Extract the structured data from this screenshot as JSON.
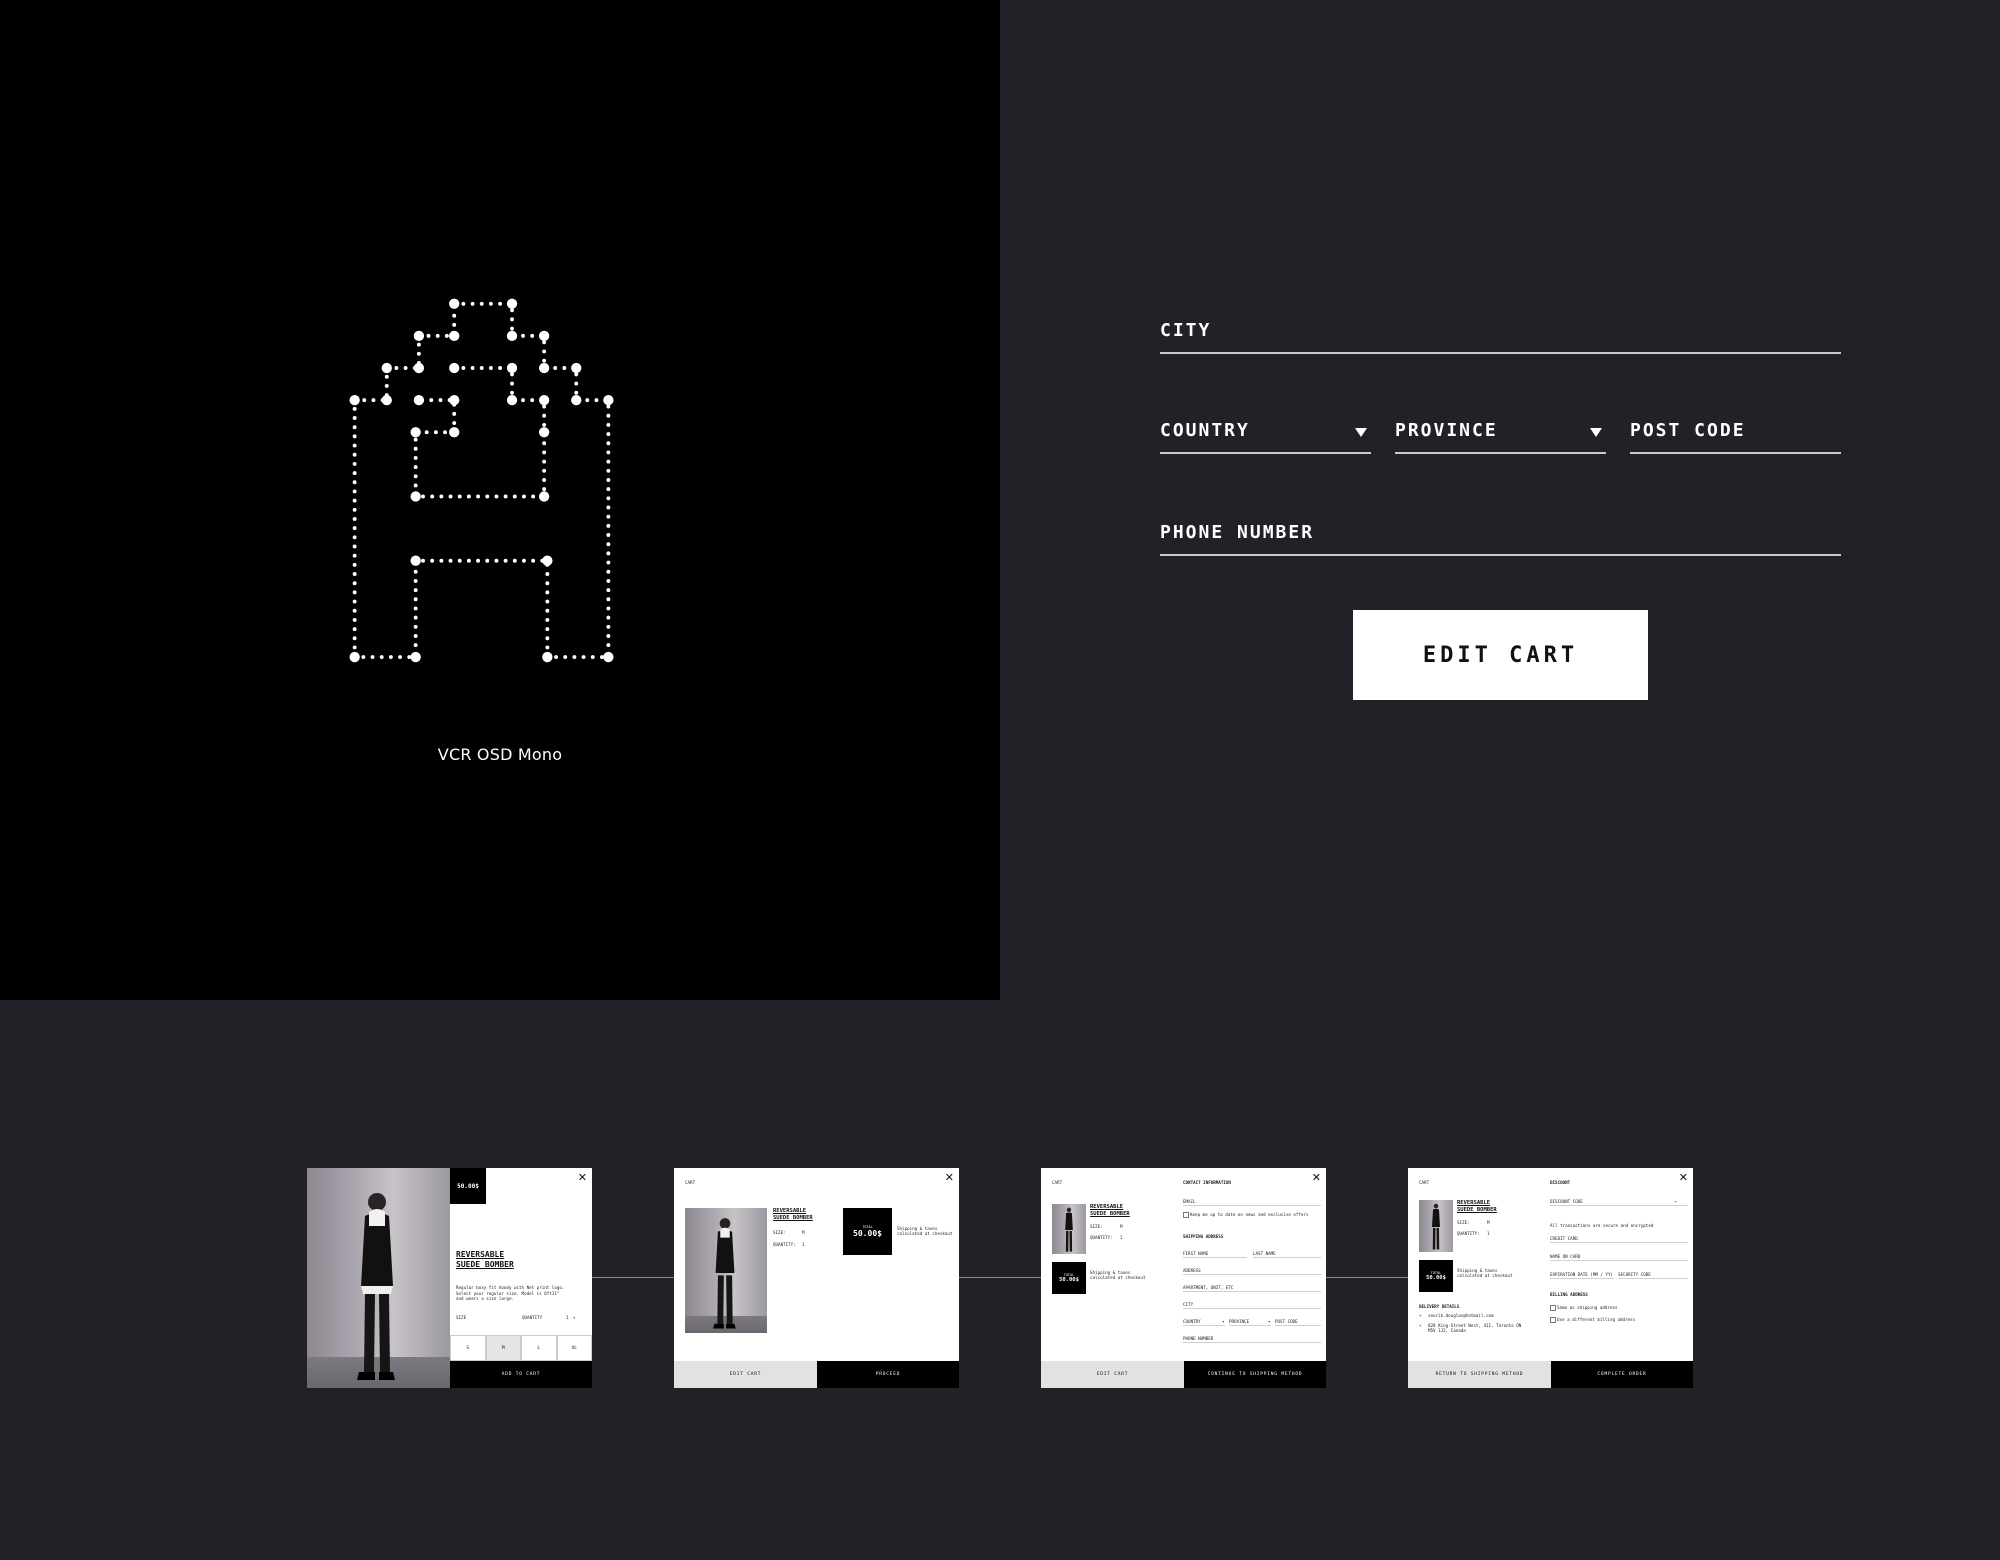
{
  "font_panel": {
    "font_name": "VCR OSD Mono"
  },
  "address_form": {
    "city_placeholder": "CITY",
    "country_placeholder": "COUNTRY",
    "province_placeholder": "PROVINCE",
    "postcode_placeholder": "POST CODE",
    "phone_placeholder": "PHONE NUMBER",
    "edit_cart_label": "EDIT CART"
  },
  "screens": {
    "product": {
      "price": "50.00$",
      "title_line1": "REVERSABLE",
      "title_line2": "SUEDE BOMBER",
      "desc_line1": "Regular boxy fit hoody with Net print logo.",
      "desc_line2": "Select your regular size. Model is 6ft11\"",
      "desc_line3": "and wears a size large.",
      "size_label": "SIZE",
      "quantity_label": "QUANTITY",
      "quantity_value": "1",
      "sizes": [
        "S",
        "M",
        "L",
        "XL"
      ],
      "add_to_cart": "ADD TO CART"
    },
    "cart": {
      "heading": "CART",
      "title_line1": "REVERSABLE",
      "title_line2": "SUEDE BOMBER",
      "size_label": "SIZE:",
      "size_value": "M",
      "quantity_label": "QUANTITY:",
      "quantity_value": "1",
      "total_label": "TOTAL",
      "total_value": "50.00$",
      "shipping_note_line1": "Shipping & taxes",
      "shipping_note_line2": "calculated at checkout",
      "edit_cart": "EDIT CART",
      "proceed": "PROCEED"
    },
    "contact": {
      "cart_heading": "CART",
      "title_line1": "REVERSABLE",
      "title_line2": "SUEDE BOMBER",
      "size_label": "SIZE:",
      "size_value": "M",
      "quantity_label": "QUANTITY:",
      "quantity_value": "1",
      "total_label": "TOTAL",
      "total_value": "50.00$",
      "shipping_note_line1": "Shipping & taxes",
      "shipping_note_line2": "calculated at checkout",
      "contact_heading": "CONTACT INFORMATION",
      "email_label": "EMAIL",
      "offers_checkbox": "Keep me up to date on news and exclusive offers",
      "shipping_heading": "SHIPPING ADDRESS",
      "first_name": "FIRST NAME",
      "last_name": "LAST NAME",
      "address": "ADDRESS",
      "apartment": "APARTMENT, UNIT, ETC",
      "city": "CITY",
      "country": "COUNTRY",
      "province": "PROVINCE",
      "post_code": "POST CODE",
      "phone": "PHONE NUMBER",
      "edit_cart": "EDIT CART",
      "continue": "CONTINUE TO SHIPPING METHOD"
    },
    "payment": {
      "cart_heading": "CART",
      "title_line1": "REVERSABLE",
      "title_line2": "SUEDE BOMBER",
      "size_label": "SIZE:",
      "size_value": "M",
      "quantity_label": "QUANTITY:",
      "quantity_value": "1",
      "total_label": "TOTAL",
      "total_value": "50.00$",
      "shipping_note_line1": "Shipping & taxes",
      "shipping_note_line2": "calculated at checkout",
      "delivery_heading": "DELIVERY DETAILS",
      "delivery_email": "seurik.douglas@hotmail.com",
      "delivery_address_line1": "828 King Street West, 411, Toronto ON",
      "delivery_address_line2": "M5V 1J2, Canada",
      "discount_heading": "DISCOUNT",
      "discount_code": "DISCOUNT CODE",
      "secure_note": "All transactions are secure and encrypted",
      "credit_card": "CREDIT CARD",
      "name_on_card": "NAME ON CARD",
      "expiration": "EXPIRATION DATE (MM / YY)",
      "security_code": "SECURITY CODE",
      "billing_heading": "BILLING ADDRESS",
      "same_as_shipping": "Same as shipping address",
      "different_billing": "Use a different billing address",
      "return": "RETURN TO SHIPPING METHOD",
      "complete": "COMPLETE ORDER"
    }
  }
}
